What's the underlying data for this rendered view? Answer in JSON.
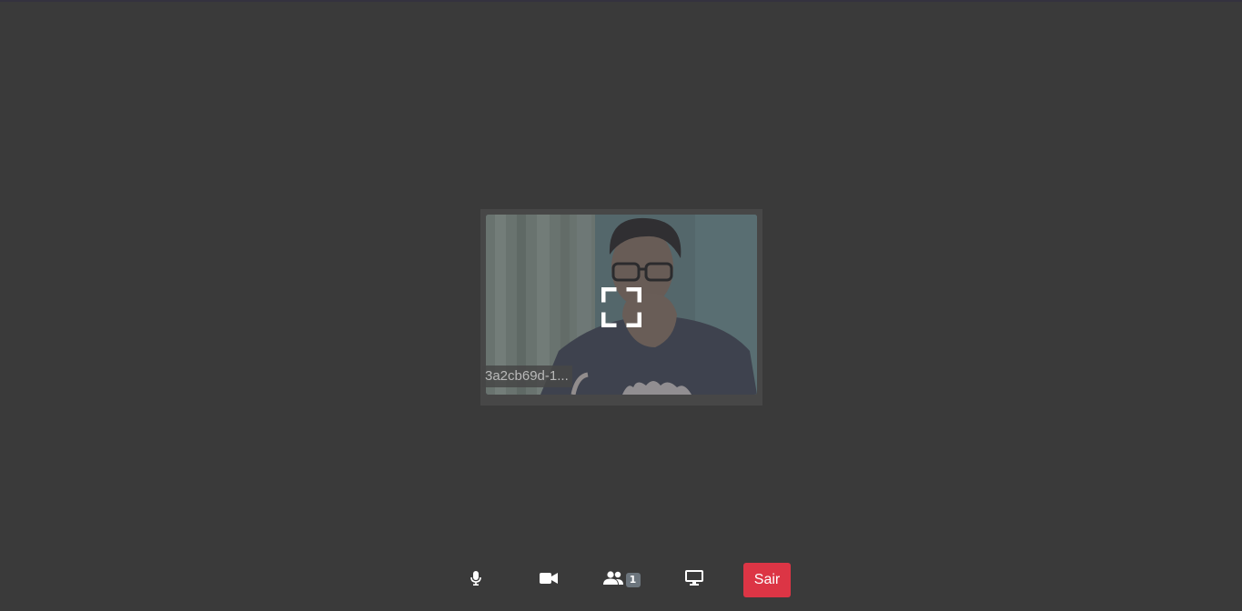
{
  "video_tile": {
    "participant_name": "3a2cb69d-1..."
  },
  "toolbar": {
    "participant_count": "1",
    "leave_label": "Sair"
  },
  "colors": {
    "background": "#3a3a3a",
    "leave_button": "#dc3545",
    "badge": "#6c757d"
  },
  "icons": {
    "fullscreen": "fullscreen-icon",
    "mic": "microphone-icon",
    "camera": "video-camera-icon",
    "participants": "users-icon",
    "screen_share": "desktop-monitor-icon"
  }
}
